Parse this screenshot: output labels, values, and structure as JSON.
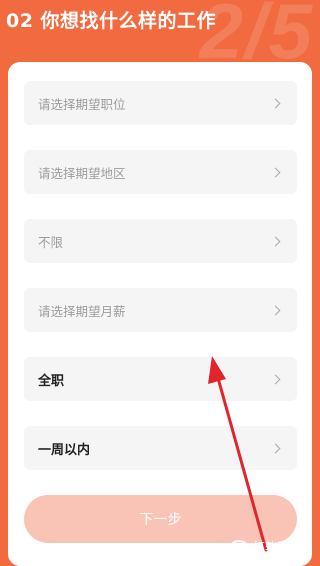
{
  "header": {
    "title": "02 你想找什么样的工作",
    "step_indicator": "2/5"
  },
  "form": {
    "options": [
      {
        "label": "请选择期望职位",
        "selected": false
      },
      {
        "label": "请选择期望地区",
        "selected": false
      },
      {
        "label": "不限",
        "selected": false
      },
      {
        "label": "请选择期望月薪",
        "selected": false
      },
      {
        "label": "全职",
        "selected": true
      },
      {
        "label": "一周以内",
        "selected": true
      }
    ],
    "next_label": "下一步"
  },
  "watermark": {
    "text": "红软网",
    "sub": "hongruan.com"
  },
  "colors": {
    "background": "#f26a3f",
    "card": "#ffffff",
    "field": "#f5f5f5",
    "button_disabled": "#f9c4b6",
    "annotation_arrow": "#e0262c"
  },
  "icons": {
    "row_chevron": "chevron-right-icon",
    "annotation": "arrow-up-icon"
  }
}
